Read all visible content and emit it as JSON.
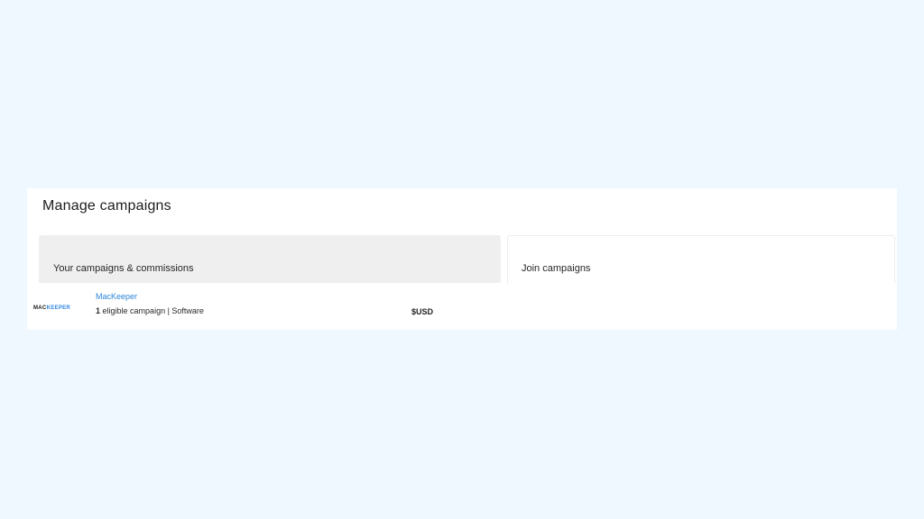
{
  "page": {
    "title": "Manage campaigns"
  },
  "tabs": [
    {
      "label": "Your campaigns & commissions",
      "active": true
    },
    {
      "label": "Join campaigns",
      "active": false
    }
  ],
  "campaigns": [
    {
      "logo": {
        "part1": "MAC",
        "part2": "KEEPER"
      },
      "name": "MacKeeper",
      "eligible_count": "1",
      "eligible_text": "eligible campaign | Software",
      "currency": "$USD"
    }
  ],
  "colors": {
    "background": "#eef8fe",
    "link": "#2b86d6",
    "active_tab": "#efefef",
    "logo_accent": "#2f86e0"
  }
}
